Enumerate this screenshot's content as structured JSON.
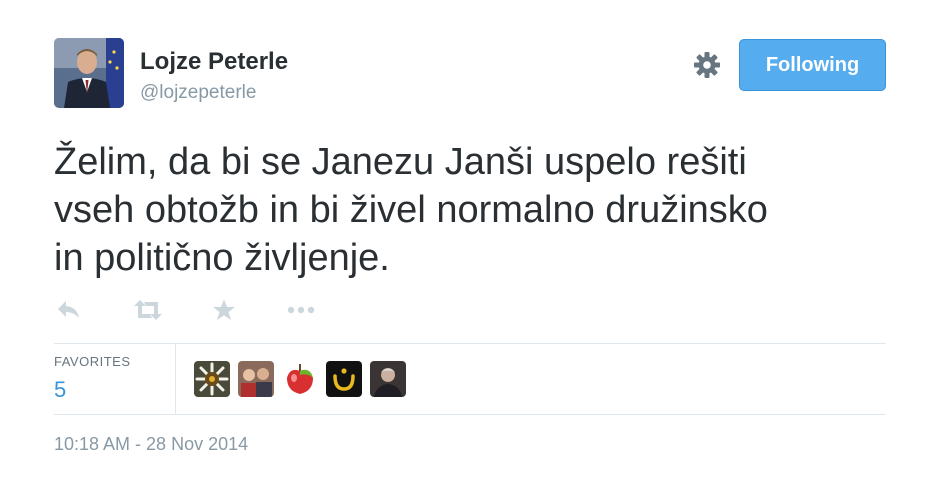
{
  "author": {
    "name": "Lojze Peterle",
    "handle": "@lojzepeterle"
  },
  "follow_button": {
    "label": "Following"
  },
  "tweet": {
    "text_lines": [
      "Želim, da bi se Janezu Janši uspelo rešiti",
      "vseh obtožb in bi živel normalno družinsko",
      "in politično življenje."
    ],
    "timestamp": "10:18 AM - 28 Nov 2014"
  },
  "stats": {
    "favorites_label": "FAVORITES",
    "favorites_count": "5"
  },
  "icons": {
    "reply": "reply-icon",
    "retweet": "retweet-icon",
    "favorite": "star-icon",
    "more": "more-icon",
    "settings": "gear-icon"
  },
  "colors": {
    "accent": "#55acee",
    "link": "#3b94d9",
    "muted": "#8899a6",
    "text": "#292f33",
    "icon": "#ccd6dd"
  }
}
